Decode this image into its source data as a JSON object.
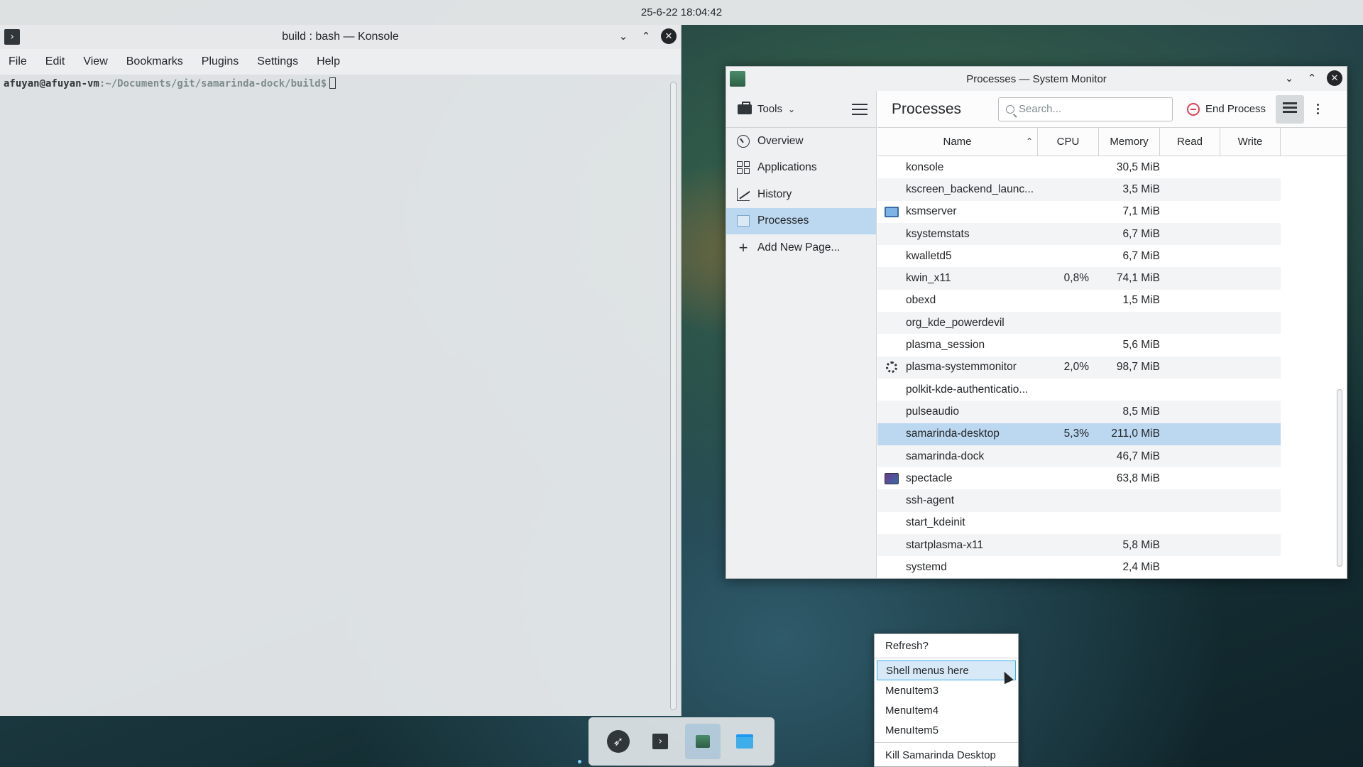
{
  "topbar": {
    "clock": "25-6-22 18:04:42"
  },
  "konsole": {
    "title": "build : bash — Konsole",
    "app_icon": "terminal-icon",
    "menu": [
      "File",
      "Edit",
      "View",
      "Bookmarks",
      "Plugins",
      "Settings",
      "Help"
    ],
    "prompt_user": "afuyan@afuyan-vm",
    "prompt_path": ":~/Documents/git/samarinda-dock/build$"
  },
  "window_controls": {
    "minimize": "⌄",
    "maximize": "⌃",
    "close": "✕"
  },
  "sysmon": {
    "title": "Processes — System Monitor",
    "tools_label": "Tools",
    "nav": [
      {
        "label": "Overview",
        "icon": "overview-icon"
      },
      {
        "label": "Applications",
        "icon": "applications-icon"
      },
      {
        "label": "History",
        "icon": "history-icon"
      },
      {
        "label": "Processes",
        "icon": "processes-icon",
        "selected": true
      },
      {
        "label": "Add New Page...",
        "icon": "plus-icon"
      }
    ],
    "page_title": "Processes",
    "search_placeholder": "Search...",
    "end_process_label": "End Process",
    "columns": [
      "Name",
      "CPU",
      "Memory",
      "Read",
      "Write"
    ],
    "rows": [
      {
        "name": "konsole",
        "cpu": "",
        "memory": "30,5 MiB",
        "icon": ""
      },
      {
        "name": "kscreen_backend_launc...",
        "cpu": "",
        "memory": "3,5 MiB",
        "icon": ""
      },
      {
        "name": "ksmserver",
        "cpu": "",
        "memory": "7,1 MiB",
        "icon": "monitor-icon"
      },
      {
        "name": "ksystemstats",
        "cpu": "",
        "memory": "6,7 MiB",
        "icon": ""
      },
      {
        "name": "kwalletd5",
        "cpu": "",
        "memory": "6,7 MiB",
        "icon": ""
      },
      {
        "name": "kwin_x11",
        "cpu": "0,8%",
        "memory": "74,1 MiB",
        "icon": ""
      },
      {
        "name": "obexd",
        "cpu": "",
        "memory": "1,5 MiB",
        "icon": ""
      },
      {
        "name": "org_kde_powerdevil",
        "cpu": "",
        "memory": "",
        "icon": ""
      },
      {
        "name": "plasma_session",
        "cpu": "",
        "memory": "5,6 MiB",
        "icon": ""
      },
      {
        "name": "plasma-systemmonitor",
        "cpu": "2,0%",
        "memory": "98,7 MiB",
        "icon": "spinner-icon"
      },
      {
        "name": "polkit-kde-authenticatio...",
        "cpu": "",
        "memory": "",
        "icon": ""
      },
      {
        "name": "pulseaudio",
        "cpu": "",
        "memory": "8,5 MiB",
        "icon": ""
      },
      {
        "name": "samarinda-desktop",
        "cpu": "5,3%",
        "memory": "211,0 MiB",
        "icon": "",
        "selected": true
      },
      {
        "name": "samarinda-dock",
        "cpu": "",
        "memory": "46,7 MiB",
        "icon": ""
      },
      {
        "name": "spectacle",
        "cpu": "",
        "memory": "63,8 MiB",
        "icon": "spectacle-icon"
      },
      {
        "name": "ssh-agent",
        "cpu": "",
        "memory": "",
        "icon": ""
      },
      {
        "name": "start_kdeinit",
        "cpu": "",
        "memory": "",
        "icon": ""
      },
      {
        "name": "startplasma-x11",
        "cpu": "",
        "memory": "5,8 MiB",
        "icon": ""
      },
      {
        "name": "systemd",
        "cpu": "",
        "memory": "2,4 MiB",
        "icon": ""
      }
    ]
  },
  "context_menu": {
    "items": [
      {
        "label": "Refresh?"
      },
      {
        "sep": true
      },
      {
        "label": "Shell menus here",
        "active": true
      },
      {
        "label": "MenuItem3"
      },
      {
        "label": "MenuItem4"
      },
      {
        "label": "MenuItem5"
      },
      {
        "sep": true
      },
      {
        "label": "Kill Samarinda Desktop"
      }
    ]
  },
  "dock": {
    "items": [
      {
        "name": "launcher",
        "icon": "rocket-icon"
      },
      {
        "name": "konsole",
        "icon": "terminal-icon"
      },
      {
        "name": "system-monitor",
        "icon": "system-monitor-icon",
        "active": true
      },
      {
        "name": "files",
        "icon": "folder-icon"
      }
    ]
  }
}
